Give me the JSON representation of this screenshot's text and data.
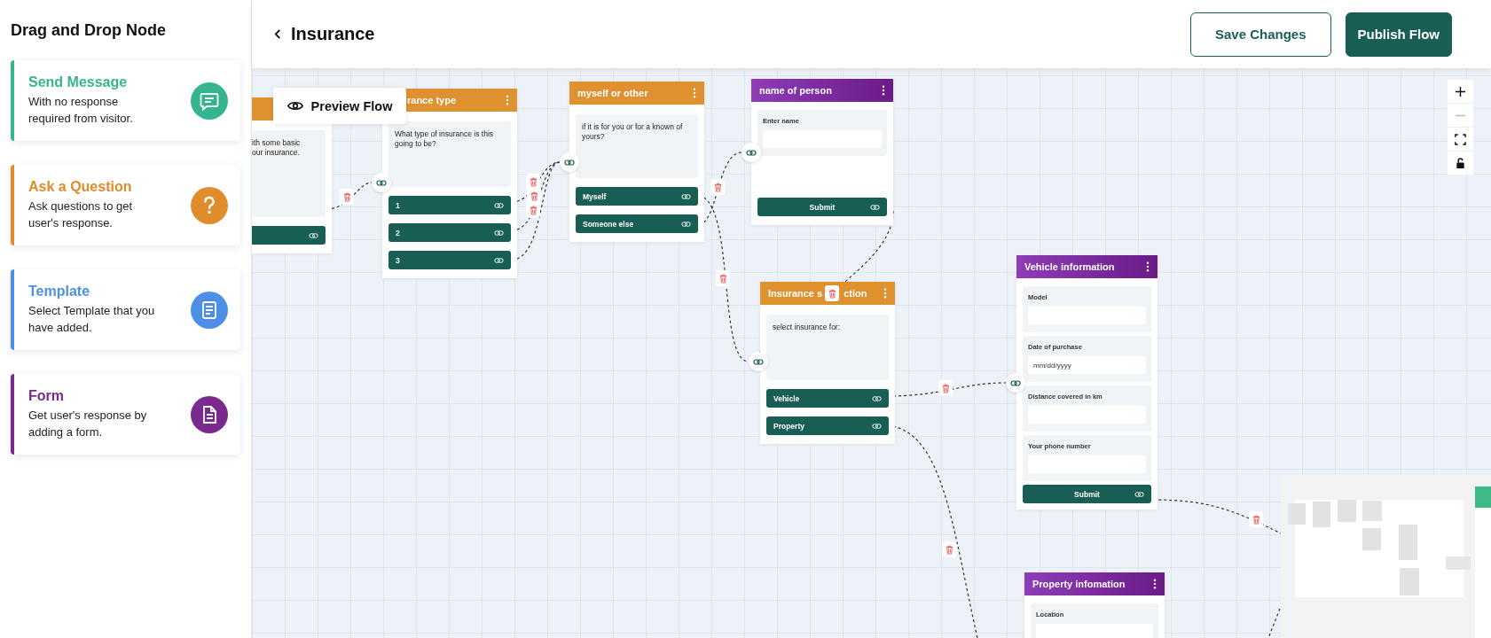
{
  "sidebar": {
    "title": "Drag and Drop Node",
    "items": [
      {
        "kind": "message",
        "title": "Send Message",
        "description": "With no response required from visitor.",
        "color": "#35b58f"
      },
      {
        "kind": "question",
        "title": "Ask a Question",
        "description": "Ask questions to get user's response.",
        "color": "#e08b2c"
      },
      {
        "kind": "template",
        "title": "Template",
        "description": "Select Template that you have added.",
        "color": "#4d8fe6"
      },
      {
        "kind": "form",
        "title": "Form",
        "description": "Get user's response by adding a form.",
        "color": "#7a2a8f"
      }
    ]
  },
  "header": {
    "title": "Insurance",
    "buttons": [
      {
        "label": "Save Changes",
        "kind": "outline"
      },
      {
        "label": "Publish Flow",
        "kind": "primary"
      }
    ]
  },
  "canvas": {
    "preview_button": "Preview Flow",
    "nodes": [
      {
        "kind": "question",
        "text": "ith some basic\nour insurance.",
        "unlabeled_option": true
      },
      {
        "kind": "question",
        "title": "rance type",
        "text": "What type of insurance is this going to be?",
        "options": [
          {
            "label": "1"
          },
          {
            "label": "2"
          },
          {
            "label": "3"
          }
        ]
      },
      {
        "kind": "question",
        "title": "myself or other",
        "text": "if it is for you or for a known of yours?",
        "options": [
          {
            "label": "Myself"
          },
          {
            "label": "Someone else"
          }
        ]
      },
      {
        "kind": "form",
        "title": "name of person",
        "fields": [
          {
            "label": "Enter name"
          }
        ],
        "submit": "Submit"
      },
      {
        "kind": "question",
        "title_parts": [
          "Insurance s",
          "ction"
        ],
        "text": "select insurance for:",
        "options": [
          {
            "label": "Vehicle"
          },
          {
            "label": "Property"
          }
        ]
      },
      {
        "kind": "form",
        "title": "Vehicle information",
        "fields": [
          {
            "label": "Model"
          },
          {
            "label": "Date of purchase",
            "placeholder": "mm/dd/yyyy"
          },
          {
            "label": "Distance covered in km"
          },
          {
            "label": "Your phone number"
          }
        ],
        "submit": "Submit"
      },
      {
        "kind": "form",
        "title": "Property infomation",
        "fields": [
          {
            "label": "Location"
          }
        ]
      }
    ]
  }
}
